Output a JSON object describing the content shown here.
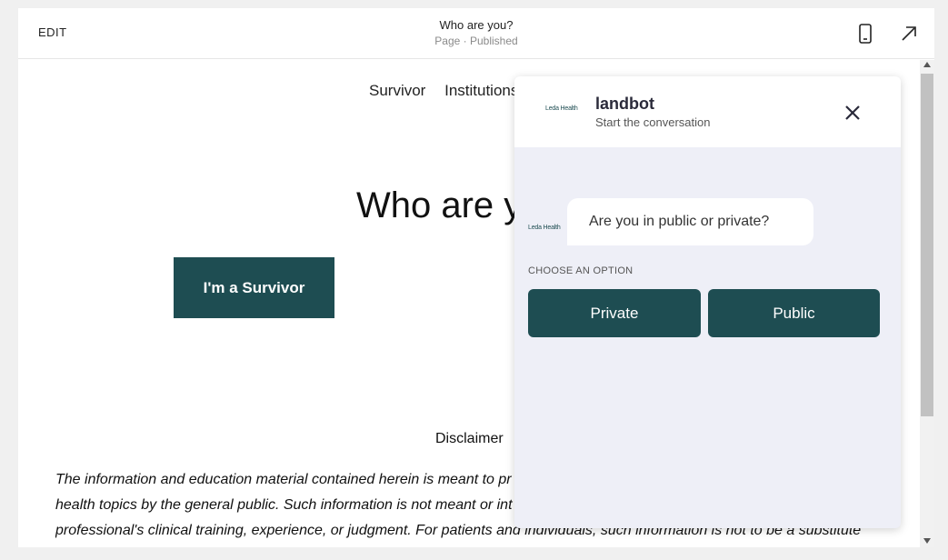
{
  "editor": {
    "edit_label": "EDIT",
    "page_title": "Who are you?",
    "page_status": "Page · Published"
  },
  "site": {
    "nav": [
      "Survivor",
      "Institutions"
    ],
    "hero_title": "Who are you?",
    "cta_label": "I'm a Survivor",
    "disclaimer_title": "Disclaimer",
    "disclaimer_lines": [
      "The information and education material contained herein is meant to pr",
      "health topics by the general public. Such information is not meant or int",
      "professional's clinical training, experience, or judgment. For patients and individuals, such information is not to be a substitute"
    ]
  },
  "chat": {
    "logo_text": "Leda Health",
    "name": "landbot",
    "subtitle": "Start the conversation",
    "message": "Are you in public or private?",
    "choose_label": "CHOOSE AN OPTION",
    "options": [
      "Private",
      "Public"
    ]
  },
  "colors": {
    "accent": "#1e4d52",
    "chat_bg": "#eeeff7"
  }
}
